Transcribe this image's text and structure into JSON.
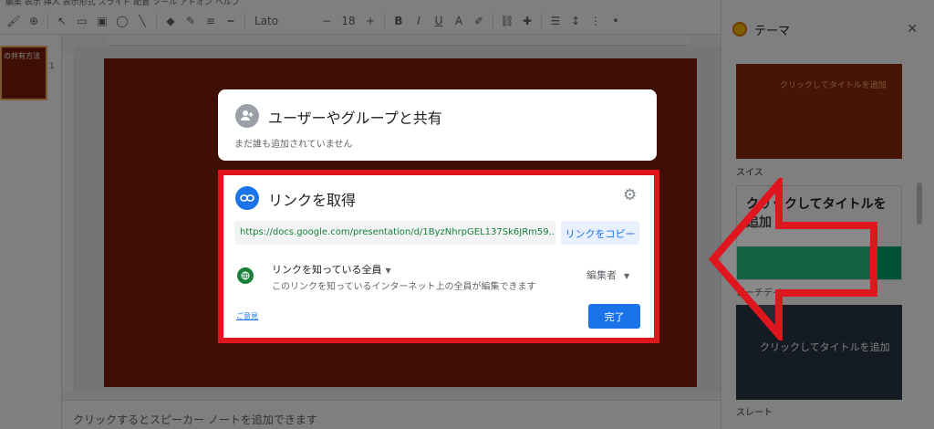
{
  "menubar": {
    "text": "編集   表示   挿入   表示形式   スライド   配置   ツール   アドオン   ヘルプ"
  },
  "toolbar": {
    "font_name": "Lato",
    "font_size": "18"
  },
  "filmstrip": {
    "slide_number": "1",
    "thumb_title": "の共有方法"
  },
  "notes": {
    "placeholder": "クリックするとスピーカー ノートを追加できます"
  },
  "theme_panel": {
    "title": "テーマ",
    "close_icon": "close-icon",
    "themes": [
      {
        "name": "スイス",
        "preview_title": "クリックしてタイトルを追加",
        "bg": "#8c2a0e"
      },
      {
        "name": "ビーチデイ",
        "preview_title": "クリックしてタイトルを追加",
        "bg": "#ffffff",
        "accent": "#00a86b"
      },
      {
        "name": "スレート",
        "preview_title": "クリックしてタイトルを追加",
        "bg": "#283645"
      }
    ]
  },
  "share_dialog": {
    "people": {
      "title": "ユーザーやグループと共有",
      "subtitle": "まだ誰も追加されていません",
      "icon": "add-person-icon"
    },
    "link": {
      "title": "リンクを取得",
      "icon": "link-icon",
      "settings_icon": "gear-icon",
      "url": "https://docs.google.com/presentation/d/1ByzNhrpGEL137Sk6JRm59...",
      "copy_label": "リンクをコピー",
      "access_title": "リンクを知っている全員",
      "access_desc": "このリンクを知っているインターネット上の全員が編集できます",
      "access_icon": "globe-icon",
      "role": "編集者",
      "feedback": "ご意見",
      "done": "完了"
    }
  },
  "colors": {
    "accent": "#1a73e8",
    "highlight": "#e0161f",
    "slide_bg": "#7e1e0c",
    "globe": "#188038"
  }
}
